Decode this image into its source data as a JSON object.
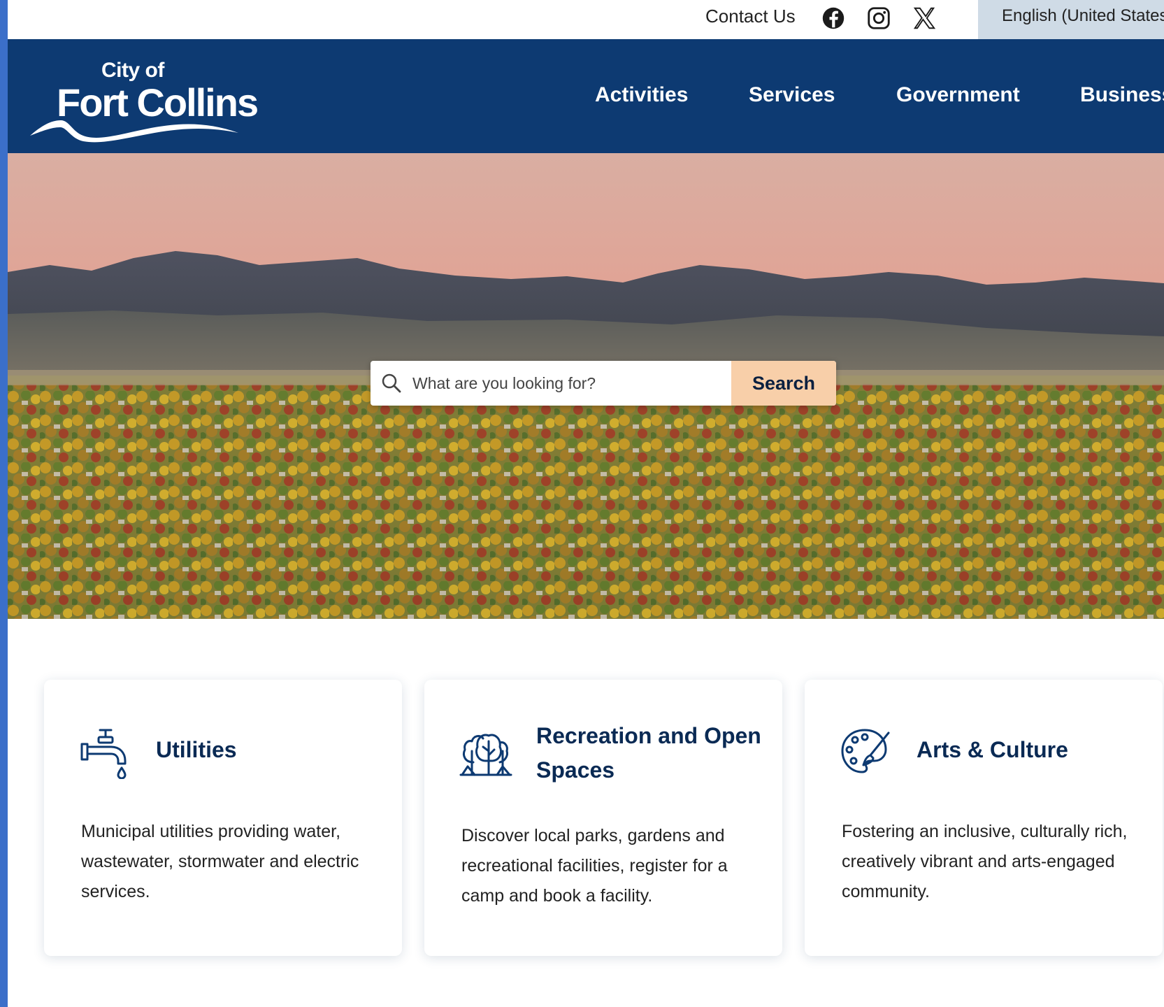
{
  "utility_bar": {
    "contact_label": "Contact Us",
    "social_icons": [
      "facebook-icon",
      "instagram-icon",
      "x-icon"
    ],
    "language": "English (United States)"
  },
  "header": {
    "logo": {
      "line1": "City of",
      "line2": "Fort Collins"
    },
    "nav": [
      "Activities",
      "Services",
      "Government",
      "Business"
    ]
  },
  "search": {
    "placeholder": "What are you looking for?",
    "button_label": "Search"
  },
  "cards": [
    {
      "icon": "faucet-icon",
      "title": "Utilities",
      "description": "Municipal utilities providing water, wastewater, stormwater and electric services."
    },
    {
      "icon": "trees-icon",
      "title": "Recreation and Open Spaces",
      "description": "Discover local parks, gardens and recreational facilities, register for a camp and book a facility."
    },
    {
      "icon": "palette-icon",
      "title": "Arts & Culture",
      "description": "Fostering an inclusive, culturally rich, creatively vibrant and arts-engaged community."
    }
  ],
  "colors": {
    "header_blue": "#0d3a72",
    "search_button": "#f8cfa9",
    "language_bg": "#cfdbe6",
    "card_title": "#0a2a54"
  }
}
